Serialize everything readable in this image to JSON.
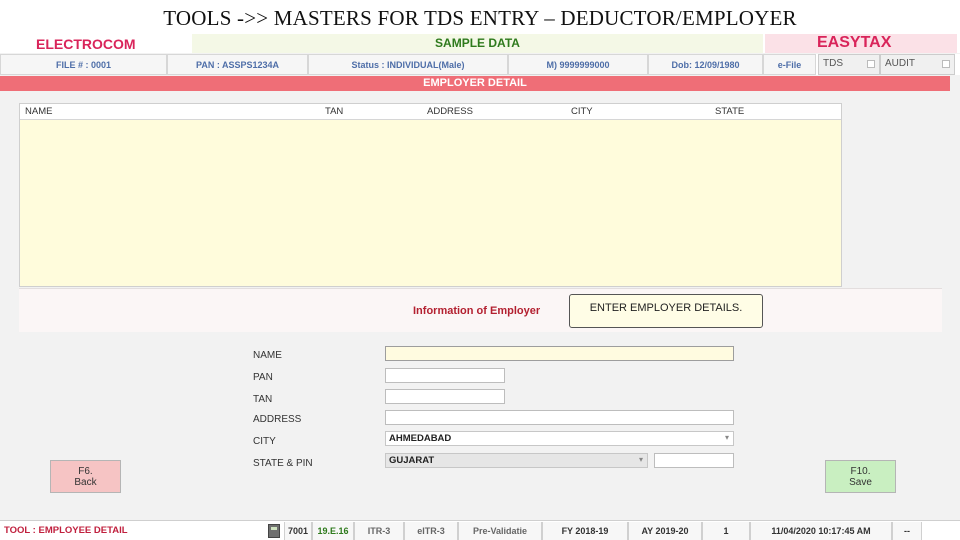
{
  "slide_title": "TOOLS ->> MASTERS FOR TDS ENTRY – DEDUCTOR/EMPLOYER",
  "brand": {
    "left": "ELECTROCOM",
    "center": "SAMPLE DATA",
    "right": "EASYTAX"
  },
  "info": {
    "file": "FILE # : 0001",
    "pan": "PAN : ASSPS1234A",
    "status": "Status : INDIVIDUAL(Male)",
    "mobile": "M) 9999999000",
    "dob": "Dob: 12/09/1980",
    "efile": "e-File",
    "tabs": [
      "TDS",
      "AUDIT"
    ]
  },
  "section_title": "EMPLOYER DETAIL",
  "grid": {
    "columns": [
      "NAME",
      "TAN",
      "ADDRESS",
      "CITY",
      "STATE"
    ],
    "rows": []
  },
  "panel": {
    "title": "Information of Employer",
    "tooltip": "ENTER EMPLOYER DETAILS."
  },
  "form": {
    "labels": {
      "name": "NAME",
      "pan": "PAN",
      "tan": "TAN",
      "address": "ADDRESS",
      "city": "CITY",
      "state_pin": "STATE & PIN"
    },
    "values": {
      "name": "",
      "pan": "",
      "tan": "",
      "address": "",
      "city": "AHMEDABAD",
      "state": "GUJARAT",
      "pin": ""
    }
  },
  "buttons": {
    "back": {
      "key": "F6.",
      "label": "Back"
    },
    "save": {
      "key": "F10.",
      "label": "Save"
    }
  },
  "status_bar": {
    "title": "TOOL : EMPLOYEE DETAIL",
    "cells": [
      "7001",
      "19.E.16",
      "ITR-3",
      "eITR-3",
      "Pre-Validatie",
      "FY 2018-19",
      "AY 2019-20",
      "1",
      "11/04/2020 10:17:45 AM",
      "--"
    ]
  },
  "colors": {
    "accent_pink": "#d9245a",
    "section_bar": "#ef6e77",
    "green": "#2e7a1c",
    "grid_bg": "#fffcdc"
  }
}
